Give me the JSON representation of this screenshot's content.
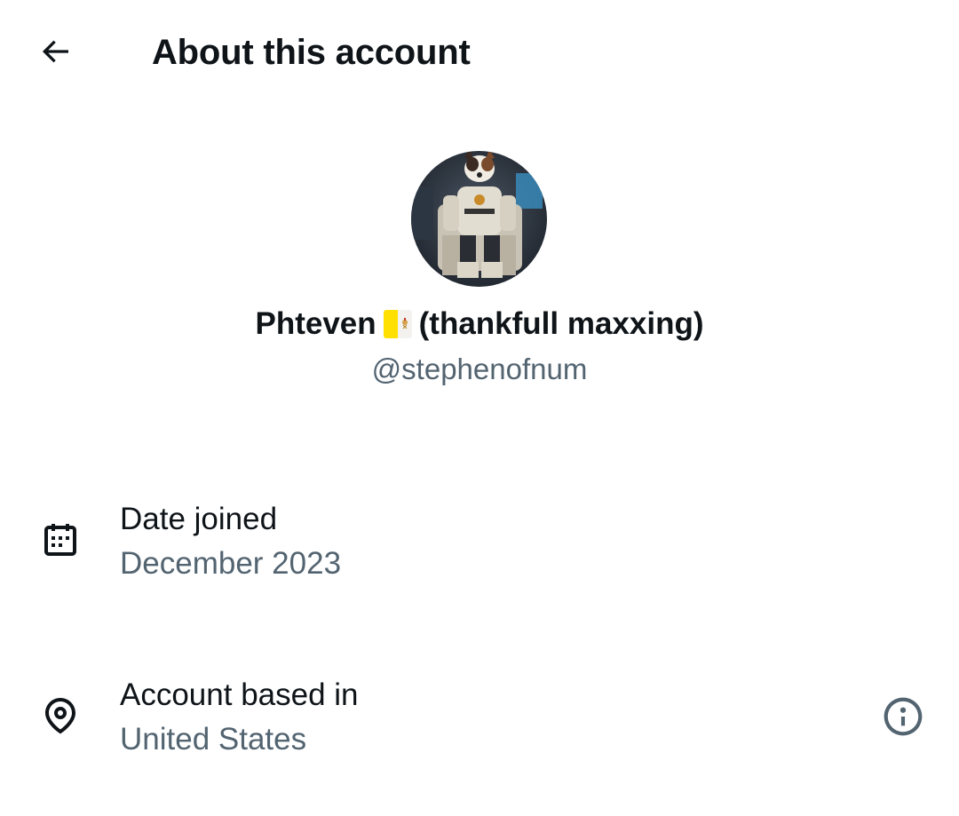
{
  "header": {
    "back_icon": "arrow-left-icon",
    "title": "About this account"
  },
  "profile": {
    "avatar_icon": "avatar-image",
    "name_part1": "Phteven",
    "flag_icon": "vatican-flag-icon",
    "name_part2": "(thankfull maxxing)",
    "handle": "@stephenofnum"
  },
  "details": {
    "joined": {
      "icon": "calendar-icon",
      "label": "Date joined",
      "value": "December 2023"
    },
    "location": {
      "icon": "location-pin-icon",
      "label": "Account based in",
      "value": "United States",
      "info_icon": "info-icon"
    }
  },
  "colors": {
    "primary_text": "#0f1419",
    "secondary_text": "#536471",
    "background": "#ffffff"
  }
}
